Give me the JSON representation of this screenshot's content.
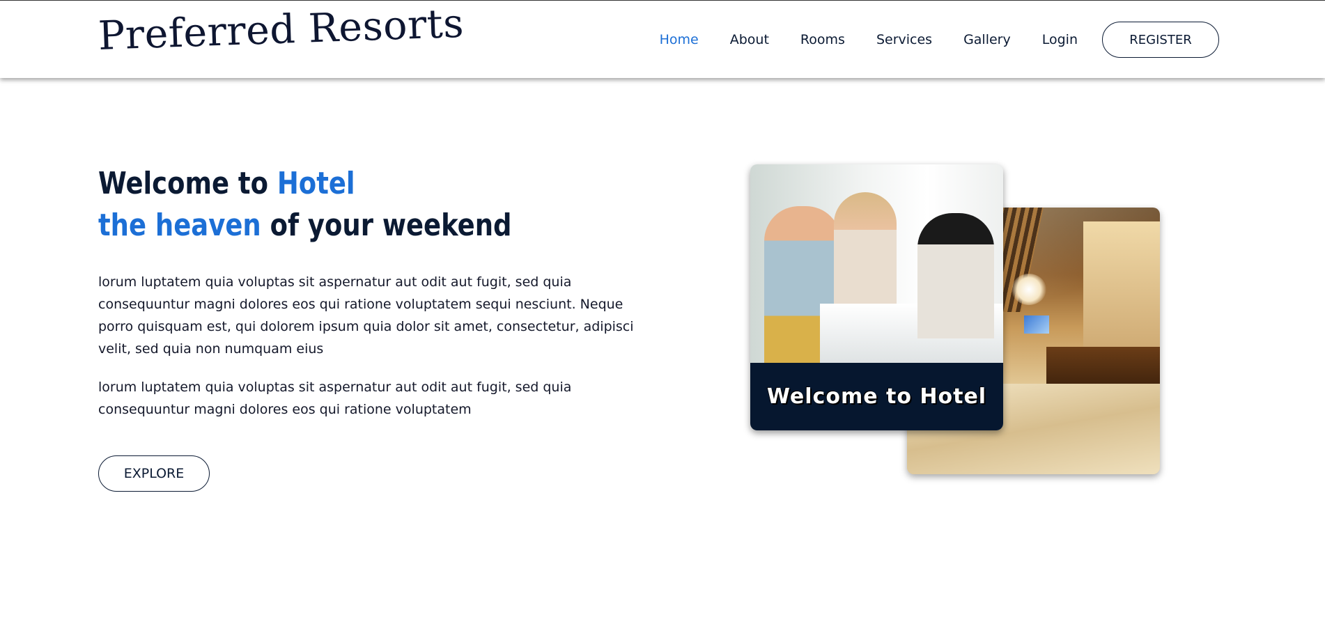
{
  "header": {
    "logo": "Preferred Resorts",
    "nav": [
      {
        "label": "Home",
        "active": true
      },
      {
        "label": "About"
      },
      {
        "label": "Rooms"
      },
      {
        "label": "Services"
      },
      {
        "label": "Gallery"
      },
      {
        "label": "Login"
      }
    ],
    "register_label": "REGISTER"
  },
  "hero": {
    "title_line1_a": "Welcome to ",
    "title_line1_b": "Hotel",
    "title_line2_a": "the heaven",
    "title_line2_b": " of your weekend",
    "paragraph1": "lorum luptatem quia voluptas sit aspernatur aut odit aut fugit, sed quia consequuntur magni dolores eos qui ratione voluptatem sequi nesciunt. Neque porro quisquam est, qui dolorem ipsum quia dolor sit amet, consectetur, adipisci velit, sed quia non numquam eius",
    "paragraph2": "lorum luptatem quia voluptas sit aspernatur aut odit aut fugit, sed quia consequuntur magni dolores eos qui ratione voluptatem",
    "explore_label": "EXPLORE"
  },
  "gallery": {
    "caption": "Welcome to Hotel"
  },
  "colors": {
    "accent": "#1c6fd6",
    "dark_navy": "#0b1a33",
    "caption_bg": "#06172f"
  }
}
